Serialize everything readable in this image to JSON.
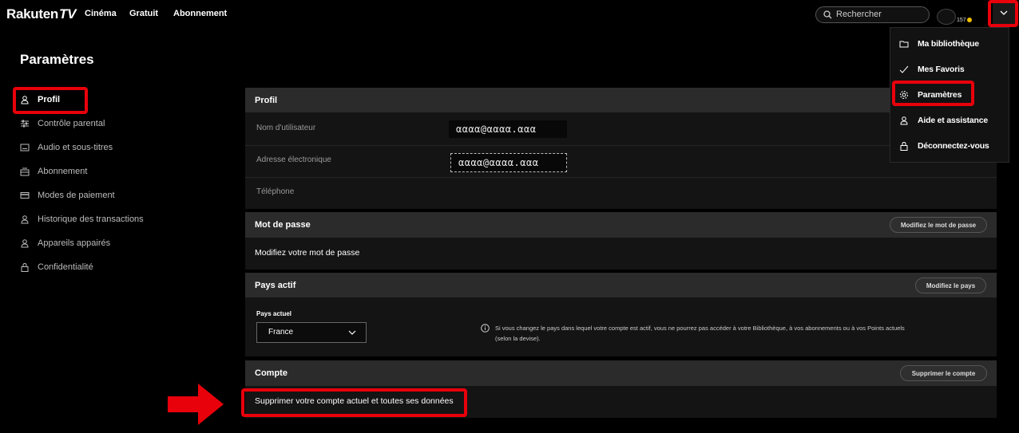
{
  "brand": {
    "logo_text": "Rakuten",
    "logo_tv": "TV"
  },
  "nav": {
    "links": [
      "Cinéma",
      "Gratuit",
      "Abonnement"
    ]
  },
  "search": {
    "placeholder": "Rechercher"
  },
  "account": {
    "points": "157"
  },
  "sidebar": {
    "title": "Paramètres",
    "items": [
      {
        "label": "Profil",
        "icon": "user-icon",
        "active": true
      },
      {
        "label": "Contrôle parental",
        "icon": "sliders-icon"
      },
      {
        "label": "Audio et sous-titres",
        "icon": "subtitles-icon"
      },
      {
        "label": "Abonnement",
        "icon": "subscription-icon"
      },
      {
        "label": "Modes de paiement",
        "icon": "credit-card-icon"
      },
      {
        "label": "Historique des transactions",
        "icon": "user-icon"
      },
      {
        "label": "Appareils appairés",
        "icon": "user-icon"
      },
      {
        "label": "Confidentialité",
        "icon": "lock-icon"
      }
    ]
  },
  "profile": {
    "title": "Profil",
    "username_label": "Nom d'utilisateur",
    "username_value": "αααα@αααα.ααα",
    "email_label": "Adresse électronique",
    "email_value": "αααα@αααα.ααα",
    "phone_label": "Téléphone"
  },
  "password": {
    "title": "Mot de passe",
    "button": "Modifiez le mot de passe",
    "text": "Modifiez votre mot de passe"
  },
  "country": {
    "title": "Pays actif",
    "button": "Modifiez le pays",
    "current_label": "Pays actuel",
    "current_value": "France",
    "info": "Si vous changez le pays dans lequel votre compte est actif, vous ne pourrez pas accéder à votre Bibliothèque, à vos abonnements ou à vos Points actuels (selon la devise)."
  },
  "account_section": {
    "title": "Compte",
    "button": "Supprimer le compte",
    "text": "Supprimer votre compte actuel et toutes ses données"
  },
  "menu": {
    "items": [
      {
        "label": "Ma bibliothèque",
        "icon": "folder-icon"
      },
      {
        "label": "Mes Favoris",
        "icon": "check-icon"
      },
      {
        "label": "Paramètres",
        "icon": "gear-icon"
      },
      {
        "label": "Aide et assistance",
        "icon": "user-icon"
      },
      {
        "label": "Déconnectez-vous",
        "icon": "lock-icon"
      }
    ]
  },
  "colors": {
    "highlight": "#e8000b",
    "background": "#000000",
    "panel": "#141414",
    "panel_header": "#2b2b2b",
    "coin": "#f0c000"
  }
}
